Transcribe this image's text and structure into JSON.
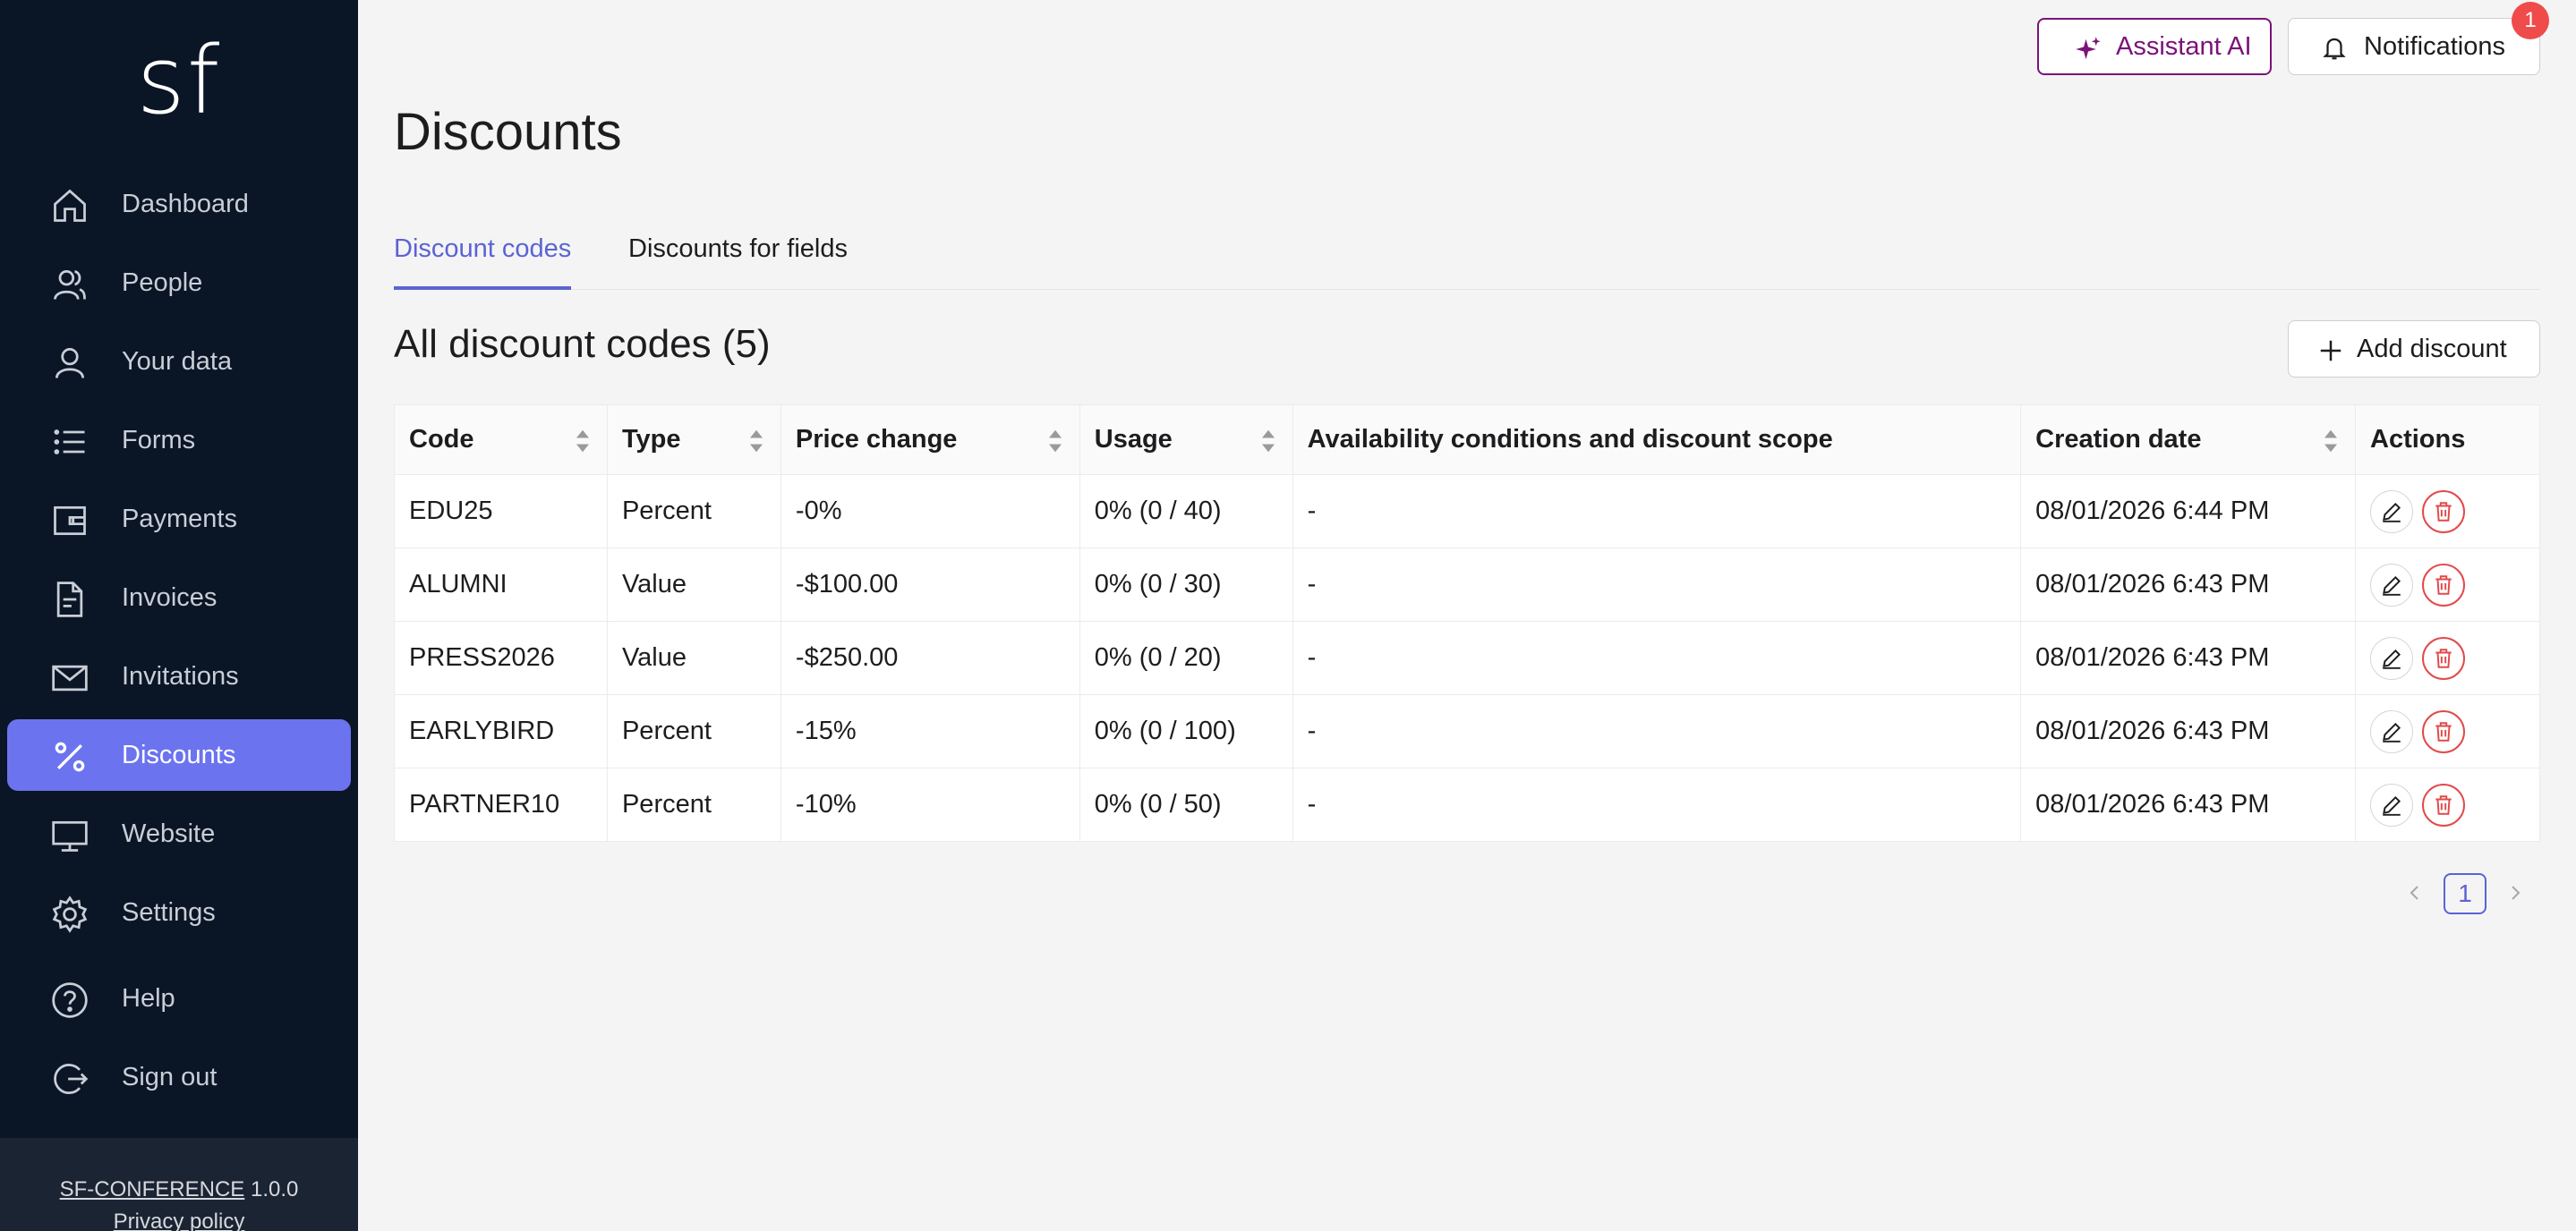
{
  "sidebar": {
    "logo": "sf",
    "items": [
      {
        "label": "Dashboard",
        "icon": "home-icon"
      },
      {
        "label": "People",
        "icon": "people-icon"
      },
      {
        "label": "Your data",
        "icon": "user-icon"
      },
      {
        "label": "Forms",
        "icon": "list-icon"
      },
      {
        "label": "Payments",
        "icon": "wallet-icon"
      },
      {
        "label": "Invoices",
        "icon": "document-icon"
      },
      {
        "label": "Invitations",
        "icon": "mail-icon"
      },
      {
        "label": "Discounts",
        "icon": "percent-icon",
        "active": true
      },
      {
        "label": "Website",
        "icon": "monitor-icon"
      },
      {
        "label": "Settings",
        "icon": "gear-icon"
      },
      {
        "label": "Help",
        "icon": "help-icon"
      },
      {
        "label": "Sign out",
        "icon": "sign-out-icon"
      }
    ],
    "footer": {
      "app_name": "SF-CONFERENCE",
      "version": "1.0.0",
      "privacy": "Privacy policy"
    }
  },
  "header": {
    "assistant_label": "Assistant AI",
    "notifications_label": "Notifications",
    "notifications_count": "1"
  },
  "page": {
    "title": "Discounts",
    "tabs": [
      {
        "label": "Discount codes",
        "active": true
      },
      {
        "label": "Discounts for fields",
        "active": false
      }
    ],
    "section_title": "All discount codes (5)",
    "add_label": "Add discount"
  },
  "table": {
    "columns": [
      "Code",
      "Type",
      "Price change",
      "Usage",
      "Availability conditions and discount scope",
      "Creation date",
      "Actions"
    ],
    "rows": [
      [
        "EDU25",
        "Percent",
        "-0%",
        "0% (0 / 40)",
        "-",
        "08/01/2026 6:44 PM"
      ],
      [
        "ALUMNI",
        "Value",
        "-$100.00",
        "0% (0 / 30)",
        "-",
        "08/01/2026 6:43 PM"
      ],
      [
        "PRESS2026",
        "Value",
        "-$250.00",
        "0% (0 / 20)",
        "-",
        "08/01/2026 6:43 PM"
      ],
      [
        "EARLYBIRD",
        "Percent",
        "-15%",
        "0% (0 / 100)",
        "-",
        "08/01/2026 6:43 PM"
      ],
      [
        "PARTNER10",
        "Percent",
        "-10%",
        "0% (0 / 50)",
        "-",
        "08/01/2026 6:43 PM"
      ]
    ]
  },
  "pagination": {
    "current": "1"
  },
  "colors": {
    "sidebar_bg": "#0a1526",
    "active_nav": "#6b73ef",
    "accent": "#5b63d3",
    "assistant": "#7a1377",
    "danger": "#e24a4a"
  }
}
